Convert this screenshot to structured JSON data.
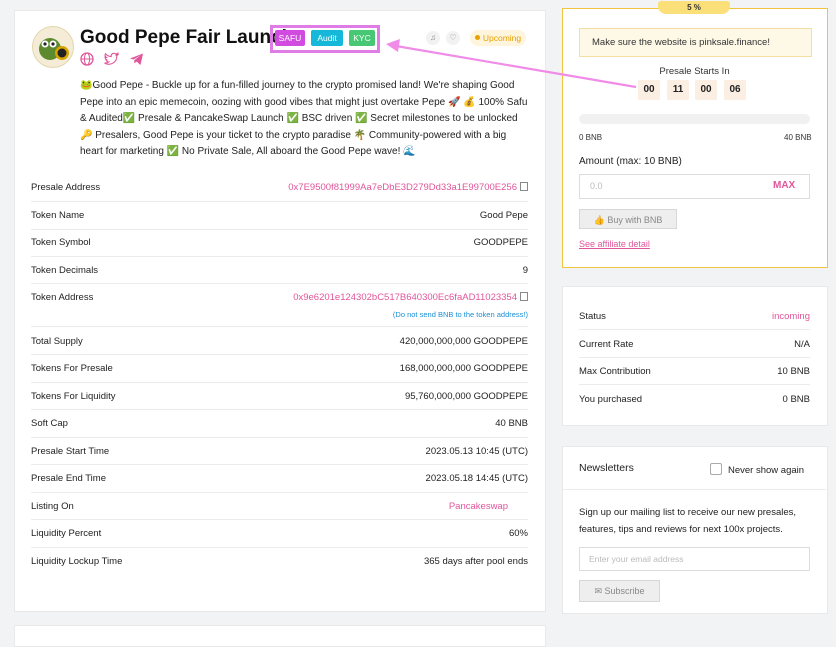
{
  "project": {
    "title": "Good Pepe Fair Launch",
    "badges": [
      "SAFU",
      "Audit",
      "KYC"
    ],
    "status_badge": "Upcoming",
    "description": "🐸Good Pepe - Buckle up for a fun-filled journey to the crypto promised land! We're shaping Good Pepe into an epic memecoin, oozing with good vibes that might just overtake Pepe 🚀 💰 100% Safu & Audited✅ Presale & PancakeSwap Launch ✅ BSC driven ✅ Secret milestones to be unlocked 🔑 Presalers, Good Pepe is your ticket to the crypto paradise 🌴 Community-powered with a big heart for marketing ✅ No Private Sale, All aboard the Good Pepe wave! 🌊",
    "socials": [
      "globe-icon",
      "twitter-icon",
      "telegram-icon"
    ]
  },
  "details": {
    "presale_address": {
      "label": "Presale Address",
      "value": "0x7E9500f81999Aa7eDbE3D279Dd33a1E99700E256"
    },
    "token_name": {
      "label": "Token Name",
      "value": "Good Pepe"
    },
    "token_symbol": {
      "label": "Token Symbol",
      "value": "GOODPEPE"
    },
    "token_decimals": {
      "label": "Token Decimals",
      "value": "9"
    },
    "token_address": {
      "label": "Token Address",
      "value": "0x9e6201e124302bC517B640300Ec6faAD11023354",
      "note": "(Do not send BNB to the token address!)"
    },
    "total_supply": {
      "label": "Total Supply",
      "value": "420,000,000,000 GOODPEPE"
    },
    "tokens_presale": {
      "label": "Tokens For Presale",
      "value": "168,000,000,000 GOODPEPE"
    },
    "tokens_liquidity": {
      "label": "Tokens For Liquidity",
      "value": "95,760,000,000 GOODPEPE"
    },
    "soft_cap": {
      "label": "Soft Cap",
      "value": "40 BNB"
    },
    "start_time": {
      "label": "Presale Start Time",
      "value": "2023.05.13 10:45 (UTC)"
    },
    "end_time": {
      "label": "Presale End Time",
      "value": "2023.05.18 14:45 (UTC)"
    },
    "listing_on": {
      "label": "Listing On",
      "value": "Pancakeswap"
    },
    "liquidity_percent": {
      "label": "Liquidity Percent",
      "value": "60%"
    },
    "lockup_time": {
      "label": "Liquidity Lockup Time",
      "value": "365 days after pool ends"
    }
  },
  "sale": {
    "progress_tab": "5 %",
    "warning": "Make sure the website is pinksale.finance!",
    "countdown_title": "Presale Starts In",
    "countdown": [
      "00",
      "11",
      "00",
      "06"
    ],
    "progress_fraction": 0,
    "min_label": "0 BNB",
    "max_label": "40 BNB",
    "amount_label": "Amount (max: 10 BNB)",
    "amount_placeholder": "0.0",
    "max_button": "MAX",
    "buy_button": "Buy with BNB",
    "affiliate_link": "See affiliate detail"
  },
  "stats": {
    "status": {
      "label": "Status",
      "value": "incoming"
    },
    "current_rate": {
      "label": "Current Rate",
      "value": "N/A"
    },
    "max_contribution": {
      "label": "Max Contribution",
      "value": "10 BNB"
    },
    "you_purchased": {
      "label": "You purchased",
      "value": "0 BNB"
    }
  },
  "newsletter": {
    "title": "Newsletters",
    "never_show": "Never show again",
    "text": "Sign up our mailing list to receive our new presales, features, tips and reviews for next 100x projects.",
    "email_placeholder": "Enter your email address",
    "subscribe_button": "Subscribe"
  },
  "colors": {
    "accent_pink": "#e0569a",
    "safu": "#d14be0",
    "audit": "#15b8d8",
    "kyc": "#48c774",
    "upcoming": "#e7a100",
    "sale_border": "#f0c43c"
  }
}
